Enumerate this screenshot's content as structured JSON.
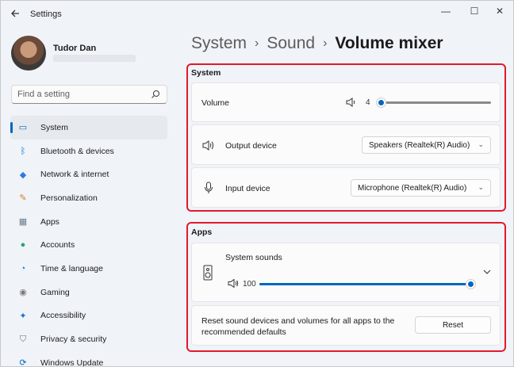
{
  "window": {
    "title": "Settings",
    "minimize_glyph": "—",
    "maximize_glyph": "☐",
    "close_glyph": "✕"
  },
  "profile": {
    "name": "Tudor Dan"
  },
  "search": {
    "placeholder": "Find a setting"
  },
  "sidebar": {
    "items": [
      {
        "label": "System",
        "icon": "system-icon",
        "glyph": "▭",
        "color": "#0067c0",
        "active": true
      },
      {
        "label": "Bluetooth & devices",
        "icon": "bluetooth-icon",
        "glyph": "ᛒ",
        "color": "#0067c0"
      },
      {
        "label": "Network & internet",
        "icon": "wifi-icon",
        "glyph": "◆",
        "color": "#2a7de1"
      },
      {
        "label": "Personalization",
        "icon": "brush-icon",
        "glyph": "✎",
        "color": "#d17a2a"
      },
      {
        "label": "Apps",
        "icon": "apps-icon",
        "glyph": "▦",
        "color": "#6c7a8a"
      },
      {
        "label": "Accounts",
        "icon": "accounts-icon",
        "glyph": "●",
        "color": "#2aa36b"
      },
      {
        "label": "Time & language",
        "icon": "clock-icon",
        "glyph": "◔",
        "color": "#1a73c8"
      },
      {
        "label": "Gaming",
        "icon": "gamepad-icon",
        "glyph": "◉",
        "color": "#7a7a7a"
      },
      {
        "label": "Accessibility",
        "icon": "accessibility-icon",
        "glyph": "✦",
        "color": "#1a73c8"
      },
      {
        "label": "Privacy & security",
        "icon": "shield-icon",
        "glyph": "⛉",
        "color": "#6d6d6d"
      },
      {
        "label": "Windows Update",
        "icon": "update-icon",
        "glyph": "⟳",
        "color": "#0067c0"
      }
    ]
  },
  "breadcrumb": {
    "part1": "System",
    "part2": "Sound",
    "current": "Volume mixer",
    "separator": "›"
  },
  "system_section": {
    "title": "System",
    "volume": {
      "label": "Volume",
      "value": "4",
      "level_percent": 4
    },
    "output": {
      "label": "Output device",
      "selected": "Speakers (Realtek(R) Audio)"
    },
    "input": {
      "label": "Input device",
      "selected": "Microphone (Realtek(R) Audio)"
    }
  },
  "apps_section": {
    "title": "Apps",
    "system_sounds": {
      "label": "System sounds",
      "value": "100",
      "level_percent": 100
    },
    "reset": {
      "text": "Reset sound devices and volumes for all apps to the recommended defaults",
      "button": "Reset"
    }
  },
  "colors": {
    "accent": "#0067c0",
    "highlight_outline": "#e2192c"
  }
}
